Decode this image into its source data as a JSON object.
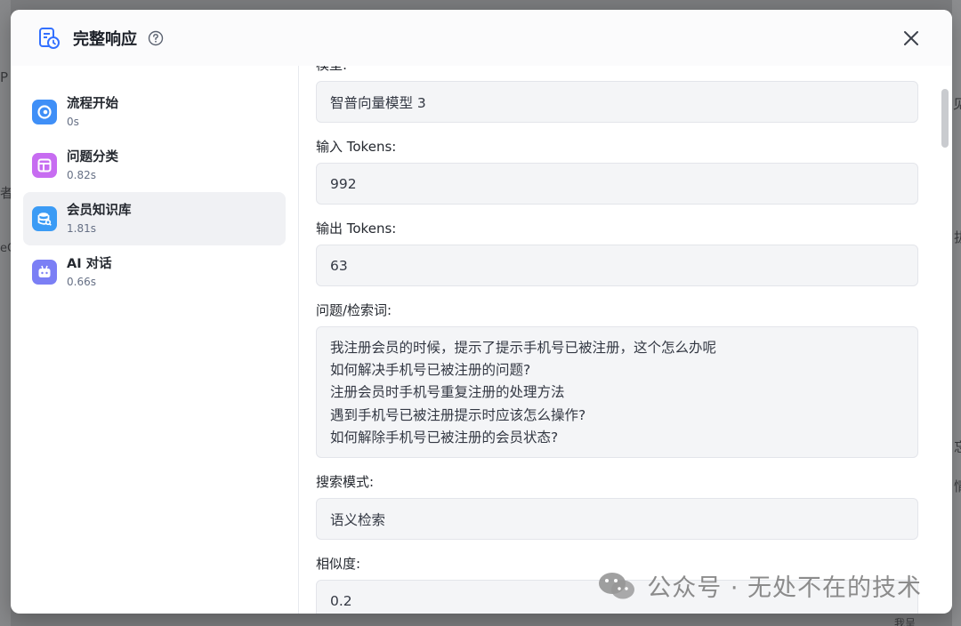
{
  "background": {
    "fragments": [
      "P",
      "者",
      "eC",
      "见",
      "拔",
      "忘",
      "情",
      "我呈"
    ]
  },
  "modal": {
    "title": "完整响应",
    "icon": "flow-history-icon",
    "help_icon": "question-circle-icon",
    "close_icon": "close-icon"
  },
  "sidebar": {
    "nodes": [
      {
        "name": "流程开始",
        "time": "0s",
        "icon": "play-icon",
        "color": "#3f8ff7"
      },
      {
        "name": "问题分类",
        "time": "0.82s",
        "icon": "layout-icon",
        "color": "#c76cf1"
      },
      {
        "name": "会员知识库",
        "time": "1.81s",
        "icon": "database-icon",
        "color": "#3b9bf5"
      },
      {
        "name": "AI 对话",
        "time": "0.66s",
        "icon": "robot-icon",
        "color": "#7b7ff5"
      }
    ],
    "active_index": 2
  },
  "details": {
    "partial_label": "模型:",
    "model_value": "智普向量模型 3",
    "input_tokens_label": "输入 Tokens:",
    "input_tokens_value": "992",
    "output_tokens_label": "输出 Tokens:",
    "output_tokens_value": "63",
    "query_label": "问题/检索词:",
    "query_lines": [
      "我注册会员的时候，提示了提示手机号已被注册，这个怎么办呢",
      "如何解决手机号已被注册的问题?",
      "注册会员时手机号重复注册的处理方法",
      "遇到手机号已被注册提示时应该怎么操作?",
      "如何解除手机号已被注册的会员状态?"
    ],
    "search_mode_label": "搜索模式:",
    "search_mode_value": "语义检索",
    "similarity_label": "相似度:",
    "similarity_value": "0.2"
  },
  "watermark": {
    "text": "公众号 · 无处不在的技术",
    "icon": "wechat-icon"
  },
  "colors": {
    "accent": "#3370ff",
    "overlay": "#7a7b7d"
  }
}
